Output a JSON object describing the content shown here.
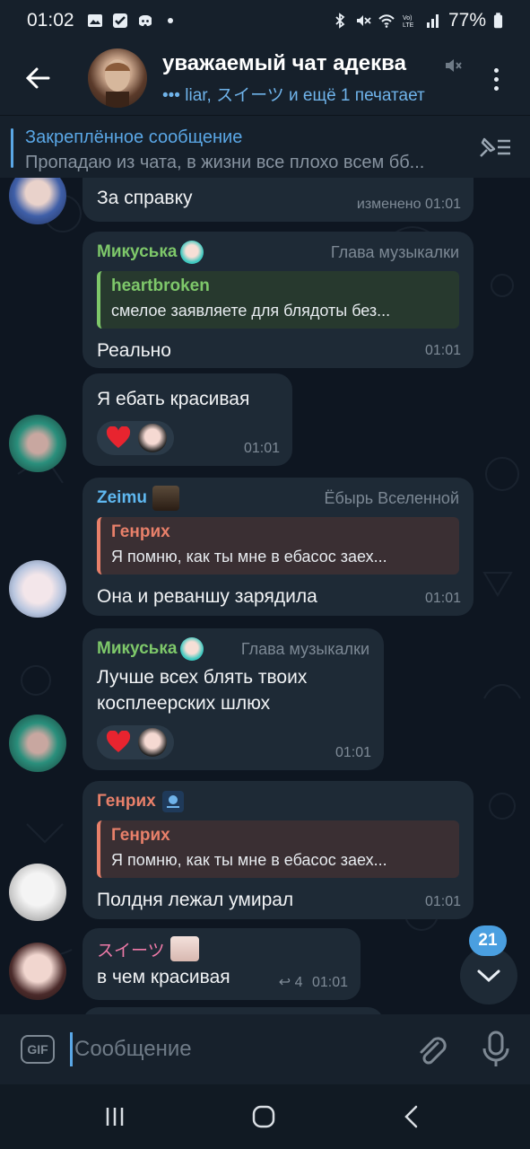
{
  "status_bar": {
    "time": "01:02",
    "battery": "77%"
  },
  "header": {
    "title": "уважаемый чат адеква",
    "subtitle": "liar, スイーツ и ещё 1 печатает"
  },
  "pinned": {
    "title": "Закреплённое сообщение",
    "text": "Пропадаю из чата, в жизни все плохо всем бб..."
  },
  "messages": [
    {
      "id": "m1",
      "text": "За справку",
      "meta": "изменено 01:01"
    },
    {
      "id": "m2",
      "sender": "Микуська",
      "role": "Глава музыкалки",
      "sender_color": "#7ec86a",
      "reply_name": "heartbroken",
      "reply_text": "смелое заявляете для блядоты без...",
      "reply_color": "#7ec86a",
      "text": "Реально",
      "meta": "01:01"
    },
    {
      "id": "m3",
      "text": "Я ебать красивая",
      "meta": "01:01",
      "reaction": "heart"
    },
    {
      "id": "m4",
      "sender": "Zeimu",
      "role": "Ёбырь Вселенной",
      "sender_color": "#5fb8f0",
      "reply_name": "Генрих",
      "reply_text": "Я помню, как ты мне в ебасос заех...",
      "reply_color": "#e8806a",
      "text": "Она и реваншу зарядила",
      "meta": "01:01"
    },
    {
      "id": "m5",
      "sender": "Микуська",
      "role": "Глава музыкалки",
      "sender_color": "#7ec86a",
      "text_line1": "Лучше всех блять твоих",
      "text_line2": "косплеерских шлюх",
      "meta": "01:01",
      "reaction": "heart"
    },
    {
      "id": "m6",
      "sender": "Генрих",
      "sender_color": "#e8806a",
      "reply_name": "Генрих",
      "reply_text": "Я помню, как ты мне в ебасос заех...",
      "reply_color": "#e8806a",
      "text": "Полдня лежал умирал",
      "meta": "01:01"
    },
    {
      "id": "m7",
      "sender": "スイーツ",
      "sender_color": "#ee7aa8",
      "text": "в чем красивая",
      "replies": "4",
      "meta": "01:01"
    }
  ],
  "scroll_badge": "21",
  "input": {
    "gif_label": "GIF",
    "placeholder": "Сообщение"
  },
  "colors": {
    "accent": "#5aa7e6",
    "bubble": "#1e2a36",
    "background": "#0e1621"
  }
}
